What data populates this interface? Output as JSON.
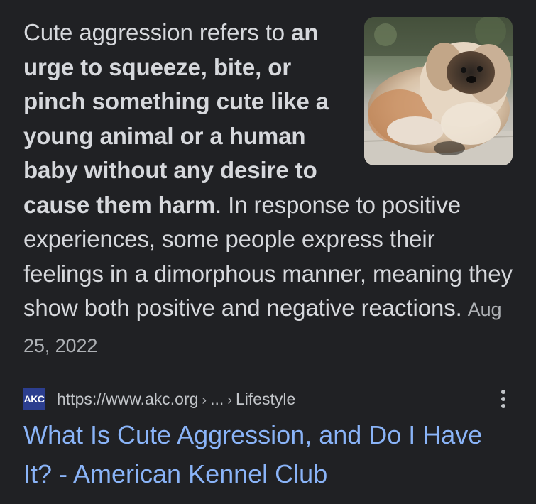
{
  "snippet": {
    "prefix": "Cute aggression refers to ",
    "bold": "an urge to squeeze, bite, or pinch something cute like a young animal or a human baby without any desire to cause them harm",
    "suffix": ". In response to positive experiences, some people express their feelings in a dimorphous manner, meaning they show both positive and negative reactions.",
    "date": "Aug 25, 2022",
    "thumbnail_icon": "pekingese-dog-photo"
  },
  "source": {
    "favicon_text": "AKC",
    "url_base": "https://www.akc.org",
    "url_sep": "›",
    "url_ellipsis": "...",
    "url_section": "Lifestyle",
    "menu_icon": "more-vert-icon"
  },
  "result": {
    "title": "What Is Cute Aggression, and Do I Have It? - American Kennel Club"
  },
  "colors": {
    "background": "#202124",
    "text": "#d6d8dc",
    "link": "#8ab4f8",
    "favicon_bg": "#2c3e8f"
  }
}
